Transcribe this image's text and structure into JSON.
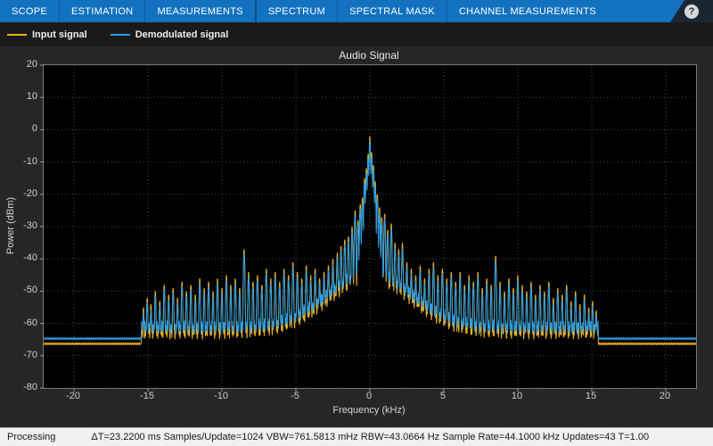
{
  "tabbar": {
    "tabs": [
      {
        "label": "SCOPE"
      },
      {
        "label": "ESTIMATION"
      },
      {
        "label": "MEASUREMENTS"
      },
      {
        "label": "SPECTRUM",
        "group_start": true
      },
      {
        "label": "SPECTRAL MASK"
      },
      {
        "label": "CHANNEL MEASUREMENTS"
      }
    ],
    "help_label": "?"
  },
  "status": {
    "processing": "Processing",
    "stats_text": "ΔT=23.2200 ms  Samples/Update=1024  VBW=761.5813 mHz  RBW=43.0664 Hz  Sample Rate=44.1000 kHz  Updates=43  T=1.00"
  },
  "chart_data": {
    "type": "line",
    "title": "Audio Signal",
    "xlabel": "Frequency (kHz)",
    "ylabel": "Power (dBm)",
    "xlim": [
      -22.05,
      22.05
    ],
    "ylim": [
      -80,
      20
    ],
    "xticks": [
      -20,
      -15,
      -10,
      -5,
      0,
      5,
      10,
      15,
      20
    ],
    "yticks": [
      20,
      10,
      0,
      -10,
      -20,
      -30,
      -40,
      -50,
      -60,
      -70,
      -80
    ],
    "grid": true,
    "legend_position": "top-left-outside",
    "plot_bg": "#000000",
    "noise_floor_dbm": -65.5,
    "band_edge_khz": 15.45,
    "band_floor_dbm": -62,
    "band_bump": 17,
    "band_shape": 16,
    "series": [
      {
        "name": "Input signal",
        "color": "#EDB120",
        "floor_offset": -0.8,
        "peak_offset": 0
      },
      {
        "name": "Demodulated signal",
        "color": "#2E9FE6",
        "floor_offset": 0.8,
        "peak_offset": -1.5
      }
    ],
    "peaks": [
      [
        0,
        -2
      ],
      [
        0.12,
        -7
      ],
      [
        -0.12,
        -7.5
      ],
      [
        0.24,
        -11
      ],
      [
        -0.24,
        -12
      ],
      [
        0.36,
        -16
      ],
      [
        -0.36,
        -15
      ],
      [
        0.5,
        -20
      ],
      [
        -0.5,
        -21
      ],
      [
        0.65,
        -24
      ],
      [
        -0.65,
        -23
      ],
      [
        0.8,
        -27
      ],
      [
        -0.8,
        -28
      ],
      [
        1.0,
        -26
      ],
      [
        -1.0,
        -25
      ],
      [
        1.2,
        -31
      ],
      [
        -1.2,
        -30
      ],
      [
        1.45,
        -29
      ],
      [
        -1.45,
        -33
      ],
      [
        1.7,
        -35
      ],
      [
        -1.7,
        -34
      ],
      [
        1.95,
        -37
      ],
      [
        -1.95,
        -36
      ],
      [
        2.2,
        -35
      ],
      [
        -2.2,
        -38
      ],
      [
        2.5,
        -41
      ],
      [
        -2.5,
        -40
      ],
      [
        2.8,
        -43
      ],
      [
        -2.8,
        -42
      ],
      [
        3.1,
        -45
      ],
      [
        3.4,
        -42
      ],
      [
        3.7,
        -46
      ],
      [
        4.0,
        -43
      ],
      [
        4.3,
        -41
      ],
      [
        4.6,
        -45
      ],
      [
        4.9,
        -43
      ],
      [
        5.2,
        -46
      ],
      [
        5.5,
        -44
      ],
      [
        5.8,
        -47
      ],
      [
        6.1,
        -44
      ],
      [
        6.4,
        -48
      ],
      [
        6.7,
        -45
      ],
      [
        7.0,
        -47
      ],
      [
        7.3,
        -44
      ],
      [
        7.6,
        -49
      ],
      [
        7.9,
        -46
      ],
      [
        8.2,
        -48
      ],
      [
        8.5,
        -39
      ],
      [
        8.8,
        -47
      ],
      [
        9.1,
        -50
      ],
      [
        9.4,
        -46
      ],
      [
        9.7,
        -49
      ],
      [
        10.0,
        -45
      ],
      [
        10.3,
        -48
      ],
      [
        10.6,
        -50
      ],
      [
        10.9,
        -47
      ],
      [
        11.2,
        -51
      ],
      [
        11.5,
        -48
      ],
      [
        11.8,
        -50
      ],
      [
        12.1,
        -47
      ],
      [
        12.4,
        -52
      ],
      [
        12.7,
        -49
      ],
      [
        13.0,
        -51
      ],
      [
        13.3,
        -48
      ],
      [
        13.6,
        -53
      ],
      [
        13.9,
        -50
      ],
      [
        14.2,
        -54
      ],
      [
        14.5,
        -51
      ],
      [
        14.8,
        -55
      ],
      [
        15.05,
        -53
      ],
      [
        15.3,
        -56
      ],
      [
        -3.1,
        -44
      ],
      [
        -3.4,
        -46
      ],
      [
        -3.7,
        -43
      ],
      [
        -4.0,
        -45
      ],
      [
        -4.3,
        -42
      ],
      [
        -4.6,
        -46
      ],
      [
        -4.9,
        -44
      ],
      [
        -5.2,
        -41
      ],
      [
        -5.5,
        -45
      ],
      [
        -5.8,
        -43
      ],
      [
        -6.1,
        -47
      ],
      [
        -6.4,
        -44
      ],
      [
        -6.7,
        -46
      ],
      [
        -7.0,
        -43
      ],
      [
        -7.3,
        -48
      ],
      [
        -7.6,
        -45
      ],
      [
        -7.9,
        -47
      ],
      [
        -8.2,
        -44
      ],
      [
        -8.5,
        -37
      ],
      [
        -8.8,
        -49
      ],
      [
        -9.1,
        -46
      ],
      [
        -9.4,
        -48
      ],
      [
        -9.7,
        -45
      ],
      [
        -10.0,
        -49
      ],
      [
        -10.3,
        -46
      ],
      [
        -10.6,
        -50
      ],
      [
        -10.9,
        -47
      ],
      [
        -11.2,
        -49
      ],
      [
        -11.5,
        -46
      ],
      [
        -11.8,
        -51
      ],
      [
        -12.1,
        -48
      ],
      [
        -12.4,
        -50
      ],
      [
        -12.7,
        -47
      ],
      [
        -13.0,
        -52
      ],
      [
        -13.3,
        -49
      ],
      [
        -13.6,
        -51
      ],
      [
        -13.9,
        -48
      ],
      [
        -14.2,
        -53
      ],
      [
        -14.5,
        -50
      ],
      [
        -14.8,
        -54
      ],
      [
        -15.05,
        -52
      ],
      [
        -15.3,
        -55
      ]
    ]
  }
}
